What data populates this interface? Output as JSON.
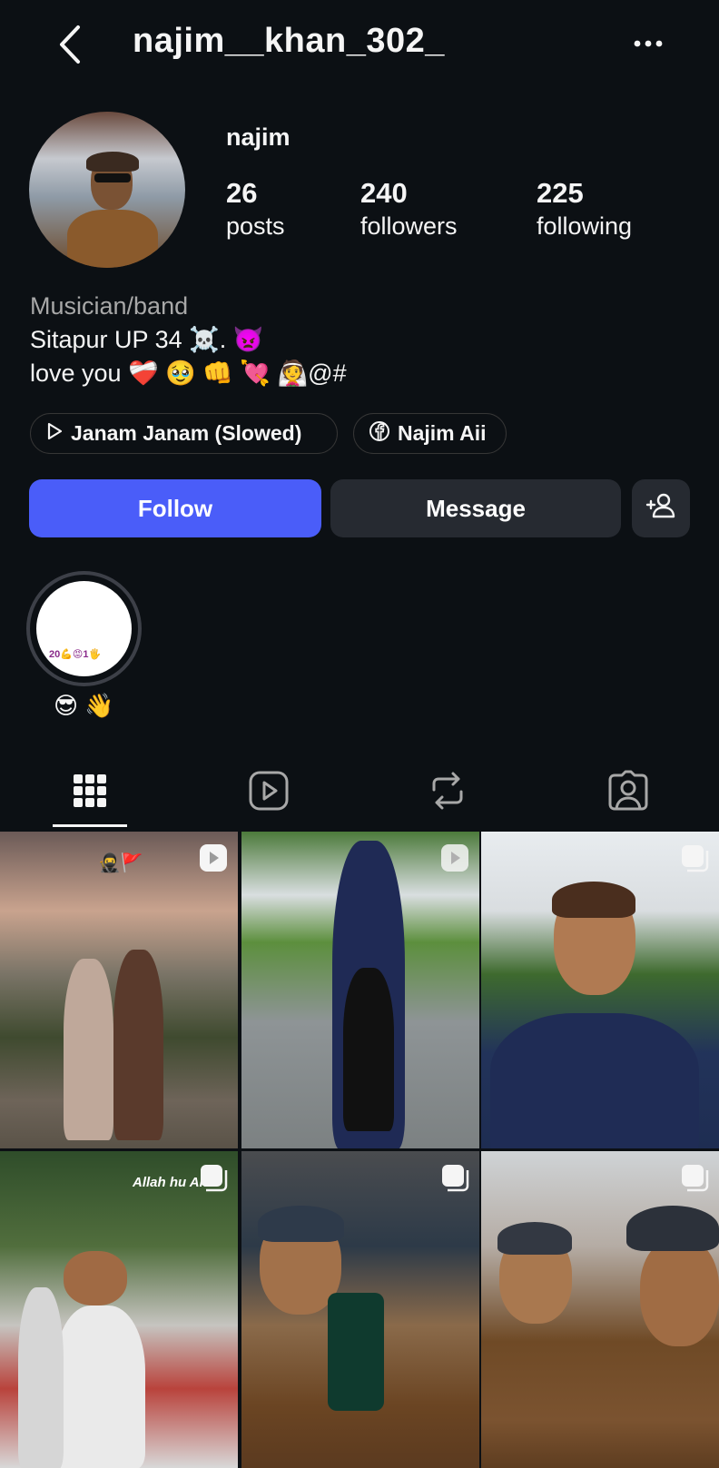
{
  "header": {
    "username": "najim__khan_302_"
  },
  "profile": {
    "full_name": "najim",
    "stats": {
      "posts_count": "26",
      "posts_label": "posts",
      "followers_count": "240",
      "followers_label": "followers",
      "following_count": "225",
      "following_label": "following"
    },
    "category": "Musician/band",
    "bio_line1": "Sitapur UP 34 ☠️. 👿",
    "bio_line2": "love you ❤️‍🩹 🥹 👊 💘 👰@#"
  },
  "chips": {
    "music": "Janam Janam (Slowed)",
    "facebook": "Najim Aii"
  },
  "actions": {
    "follow": "Follow",
    "message": "Message"
  },
  "highlight": {
    "cover_text": "20💪😡1🖐",
    "label": "😎 👋"
  },
  "tabs": [
    "grid-icon",
    "reels-icon",
    "reposts-icon",
    "tagged-icon"
  ],
  "posts": [
    {
      "type": "reel",
      "overlay_text": "🥷🚩"
    },
    {
      "type": "reel",
      "overlay_text": ""
    },
    {
      "type": "carousel",
      "overlay_text": ""
    },
    {
      "type": "carousel",
      "overlay_text": "Allah hu Ak"
    },
    {
      "type": "carousel",
      "overlay_text": ""
    },
    {
      "type": "carousel",
      "overlay_text": ""
    }
  ],
  "colors": {
    "background": "#0c1014",
    "follow_button": "#4a5df9",
    "secondary_button": "#262a31",
    "muted_text": "#a8a8a8"
  }
}
